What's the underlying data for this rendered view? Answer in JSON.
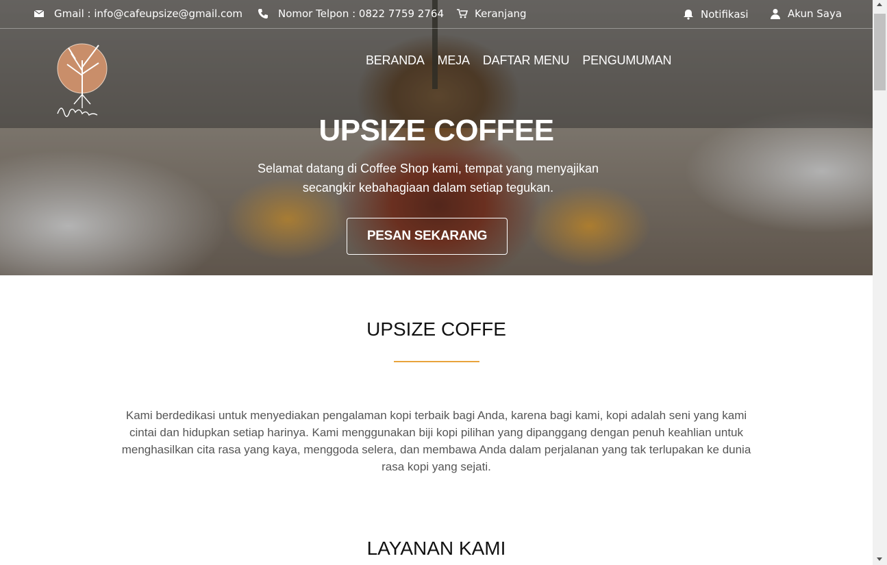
{
  "topbar": {
    "email": "Gmail : info@cafeupsize@gmail.com",
    "phone": "Nomor Telpon : 0822 7759 2764",
    "cart": "Keranjang",
    "notifications": "Notifikasi",
    "account": "Akun Saya"
  },
  "nav": {
    "items": [
      "BERANDA",
      "MEJA",
      "DAFTAR MENU",
      "PENGUMUMAN"
    ]
  },
  "hero": {
    "title": "UPSIZE COFFEE",
    "subtitle": "Selamat datang di Coffee Shop kami, tempat yang menyajikan secangkir kebahagiaan dalam setiap tegukan.",
    "cta": "PESAN SEKARANG"
  },
  "about": {
    "title": "UPSIZE COFFE",
    "text": "Kami berdedikasi untuk menyediakan pengalaman kopi terbaik bagi Anda, karena bagi kami, kopi adalah seni yang kami cintai dan hidupkan setiap harinya. Kami menggunakan biji kopi pilihan yang dipanggang dengan penuh keahlian untuk menghasilkan cita rasa yang kaya, menggoda selera, dan membawa Anda dalam perjalanan yang tak terlupakan ke dunia rasa kopi yang sejati."
  },
  "services": {
    "title": "LAYANAN KAMI"
  },
  "colors": {
    "accent": "#e8a33b",
    "logo_circle": "#c98e6a"
  },
  "icons": [
    "mail-icon",
    "phone-icon",
    "cart-icon",
    "bell-icon",
    "user-icon",
    "upsize-logo"
  ]
}
